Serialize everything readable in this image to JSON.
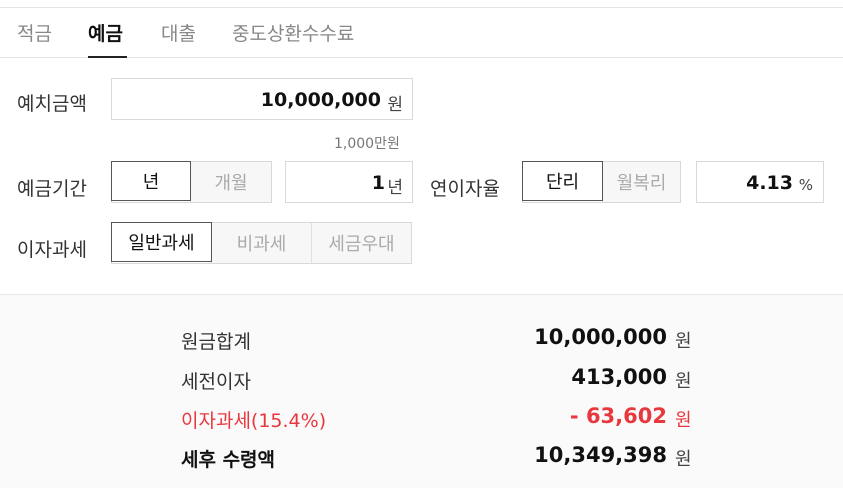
{
  "tabs": [
    {
      "label": "적금",
      "active": false
    },
    {
      "label": "예금",
      "active": true
    },
    {
      "label": "대출",
      "active": false
    },
    {
      "label": "중도상환수수료",
      "active": false
    }
  ],
  "deposit_amount": {
    "label": "예치금액",
    "value": "10,000,000",
    "unit": "원",
    "hint": "1,000만원"
  },
  "period": {
    "label": "예금기간",
    "options": [
      "년",
      "개월"
    ],
    "selected": "년",
    "value": "1",
    "unit": "년"
  },
  "rate": {
    "label": "연이자율",
    "options": [
      "단리",
      "월복리"
    ],
    "selected": "단리",
    "value": "4.13",
    "unit": "%"
  },
  "tax": {
    "label": "이자과세",
    "options": [
      "일반과세",
      "비과세",
      "세금우대"
    ],
    "selected": "일반과세"
  },
  "results": {
    "principal": {
      "label": "원금합계",
      "value": "10,000,000",
      "unit": "원"
    },
    "pretax_interest": {
      "label": "세전이자",
      "value": "413,000",
      "unit": "원"
    },
    "interest_tax": {
      "label": "이자과세(15.4%)",
      "value": "- 63,602",
      "unit": "원",
      "color": "#e8383d"
    },
    "net_amount": {
      "label": "세후 수령액",
      "value": "10,349,398",
      "unit": "원"
    }
  }
}
